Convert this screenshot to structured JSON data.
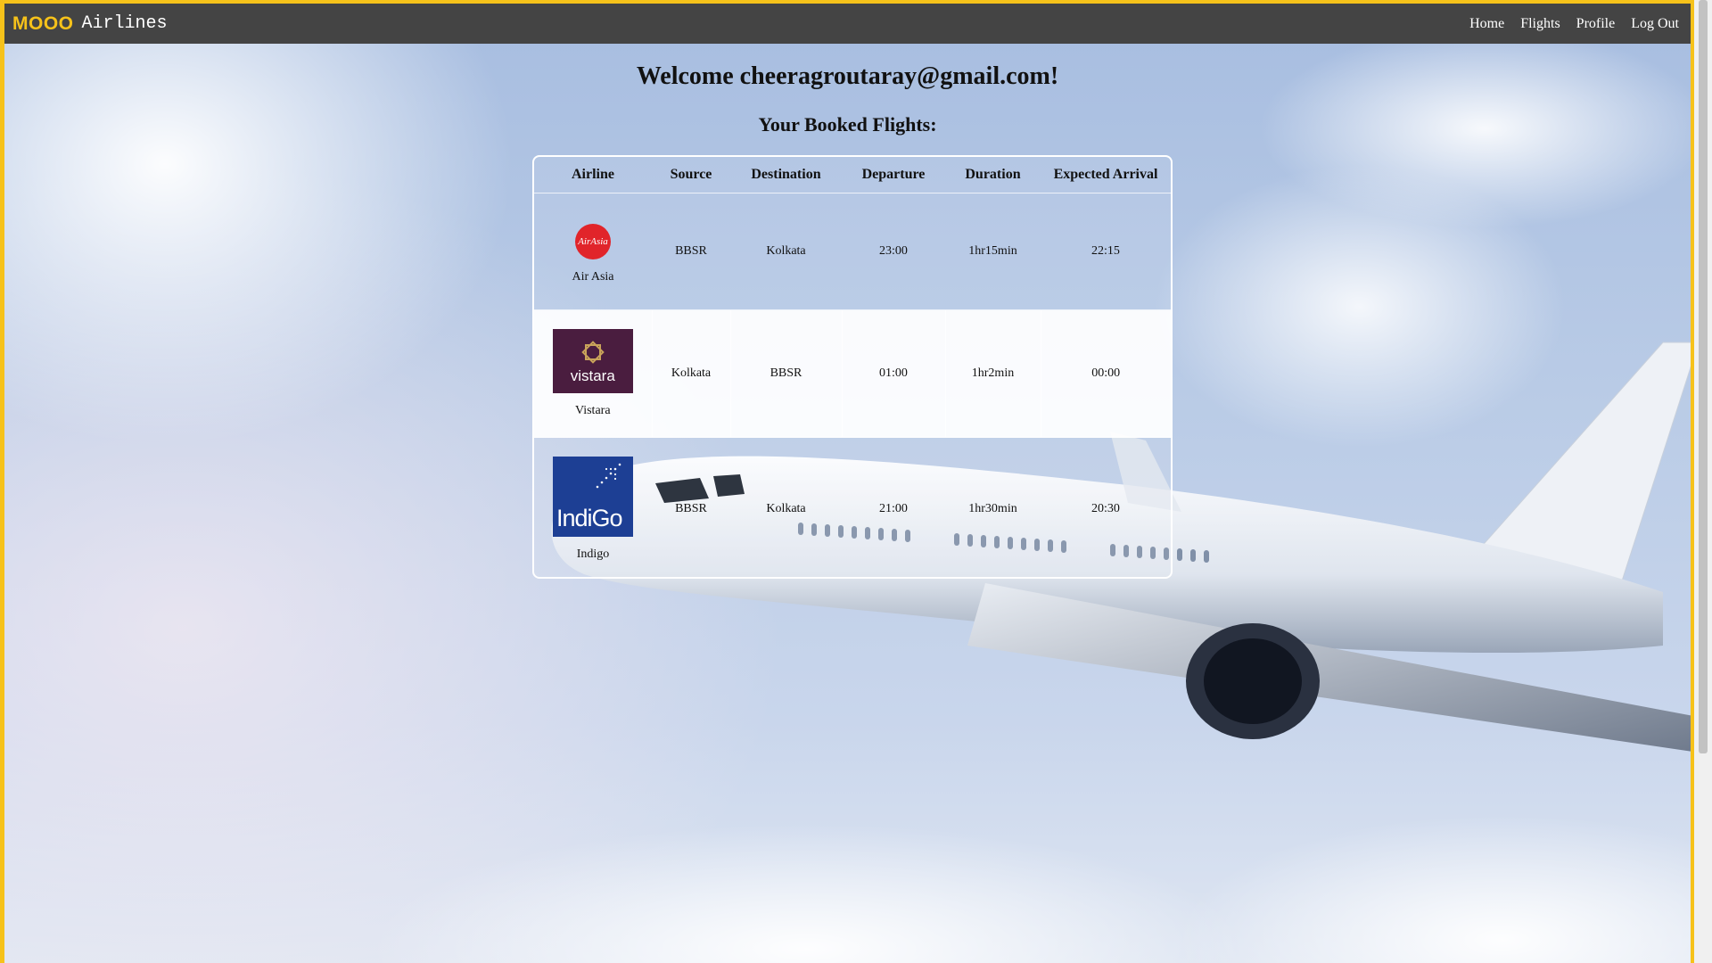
{
  "navbar": {
    "brand_strong": "MOOO",
    "brand_light": "Airlines",
    "links": [
      "Home",
      "Flights",
      "Profile",
      "Log Out"
    ]
  },
  "main": {
    "welcome": "Welcome cheeragroutaray@gmail.com!",
    "subheading": "Your Booked Flights:"
  },
  "table": {
    "headers": [
      "Airline",
      "Source",
      "Destination",
      "Departure",
      "Duration",
      "Expected Arrival"
    ],
    "rows": [
      {
        "airline": "Air Asia",
        "logo": "airasia-logo",
        "logo_text": "AirAsia",
        "source": "BBSR",
        "destination": "Kolkata",
        "departure": "23:00",
        "duration": "1hr15min",
        "arrival": "22:15"
      },
      {
        "airline": "Vistara",
        "logo": "vistara-logo",
        "logo_text": "vistara",
        "source": "Kolkata",
        "destination": "BBSR",
        "departure": "01:00",
        "duration": "1hr2min",
        "arrival": "00:00"
      },
      {
        "airline": "Indigo",
        "logo": "indigo-logo",
        "logo_text": "IndiGo",
        "source": "BBSR",
        "destination": "Kolkata",
        "departure": "21:00",
        "duration": "1hr30min",
        "arrival": "20:30"
      }
    ]
  },
  "colors": {
    "accent": "#f6c21a",
    "navbar": "#444444",
    "airasia": "#e1242a",
    "vistara": "#4a1d3f",
    "indigo": "#1d3f94"
  }
}
